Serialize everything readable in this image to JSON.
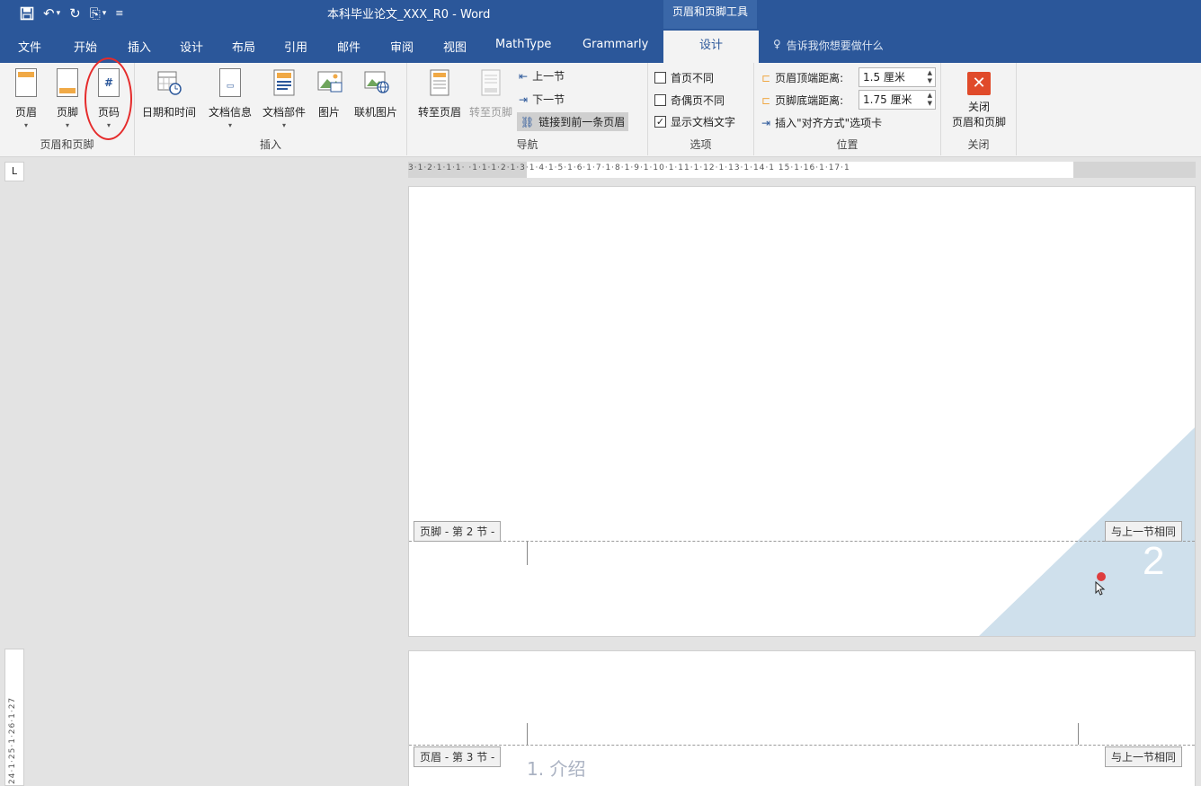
{
  "titlebar": {
    "doc_title": "本科毕业论文_XXX_R0 - Word",
    "contextual_group": "页眉和页脚工具",
    "qat": {
      "save": "save-icon",
      "undo": "undo-icon",
      "redo": "redo-icon",
      "check": "check-doc-icon",
      "customize": "customize-qat-icon"
    }
  },
  "tabs": [
    "文件",
    "开始",
    "插入",
    "设计",
    "布局",
    "引用",
    "邮件",
    "审阅",
    "视图",
    "MathType",
    "Grammarly"
  ],
  "active_tab": "设计",
  "tellme": "告诉我你想要做什么",
  "ribbon": {
    "group_header_footer": {
      "label": "页眉和页脚",
      "header": "页眉",
      "footer": "页脚",
      "page_number": "页码"
    },
    "group_insert": {
      "label": "插入",
      "datetime": "日期和时间",
      "docinfo": "文档信息",
      "quickparts": "文档部件",
      "picture": "图片",
      "online_picture": "联机图片"
    },
    "group_nav": {
      "label": "导航",
      "goto_header": "转至页眉",
      "goto_footer": "转至页脚",
      "prev_section": "上一节",
      "next_section": "下一节",
      "link_previous": "链接到前一条页眉"
    },
    "group_options": {
      "label": "选项",
      "diff_first": "首页不同",
      "diff_odd_even": "奇偶页不同",
      "show_doc_text": "显示文档文字",
      "diff_first_checked": false,
      "diff_odd_even_checked": false,
      "show_doc_text_checked": true
    },
    "group_position": {
      "label": "位置",
      "header_from_top_label": "页眉顶端距离:",
      "header_from_top_value": "1.5 厘米",
      "footer_from_bottom_label": "页脚底端距离:",
      "footer_from_bottom_value": "1.75 厘米",
      "insert_align_tab": "插入\"对齐方式\"选项卡"
    },
    "group_close": {
      "label": "关闭",
      "close_line1": "关闭",
      "close_line2": "页眉和页脚"
    }
  },
  "ruler": {
    "marks": "3·1·2·1·1·1·  ·1·1·1·2·1·3·1·4·1·5·1·6·1·7·1·8·1·9·1·10·1·11·1·12·1·13·1·14·1  15·1·16·1·17·1",
    "vertical_marks": "24·1·25·1·26·1·27"
  },
  "page1": {
    "footer_tag": "页脚 - 第 2 节 -",
    "same_as_prev": "与上一节相同",
    "page_number": "2",
    "triangle_color": "#cfe0ec"
  },
  "page2": {
    "header_tag": "页眉 - 第 3 节 -",
    "same_as_prev": "与上一节相同",
    "heading": "1. 介绍"
  }
}
